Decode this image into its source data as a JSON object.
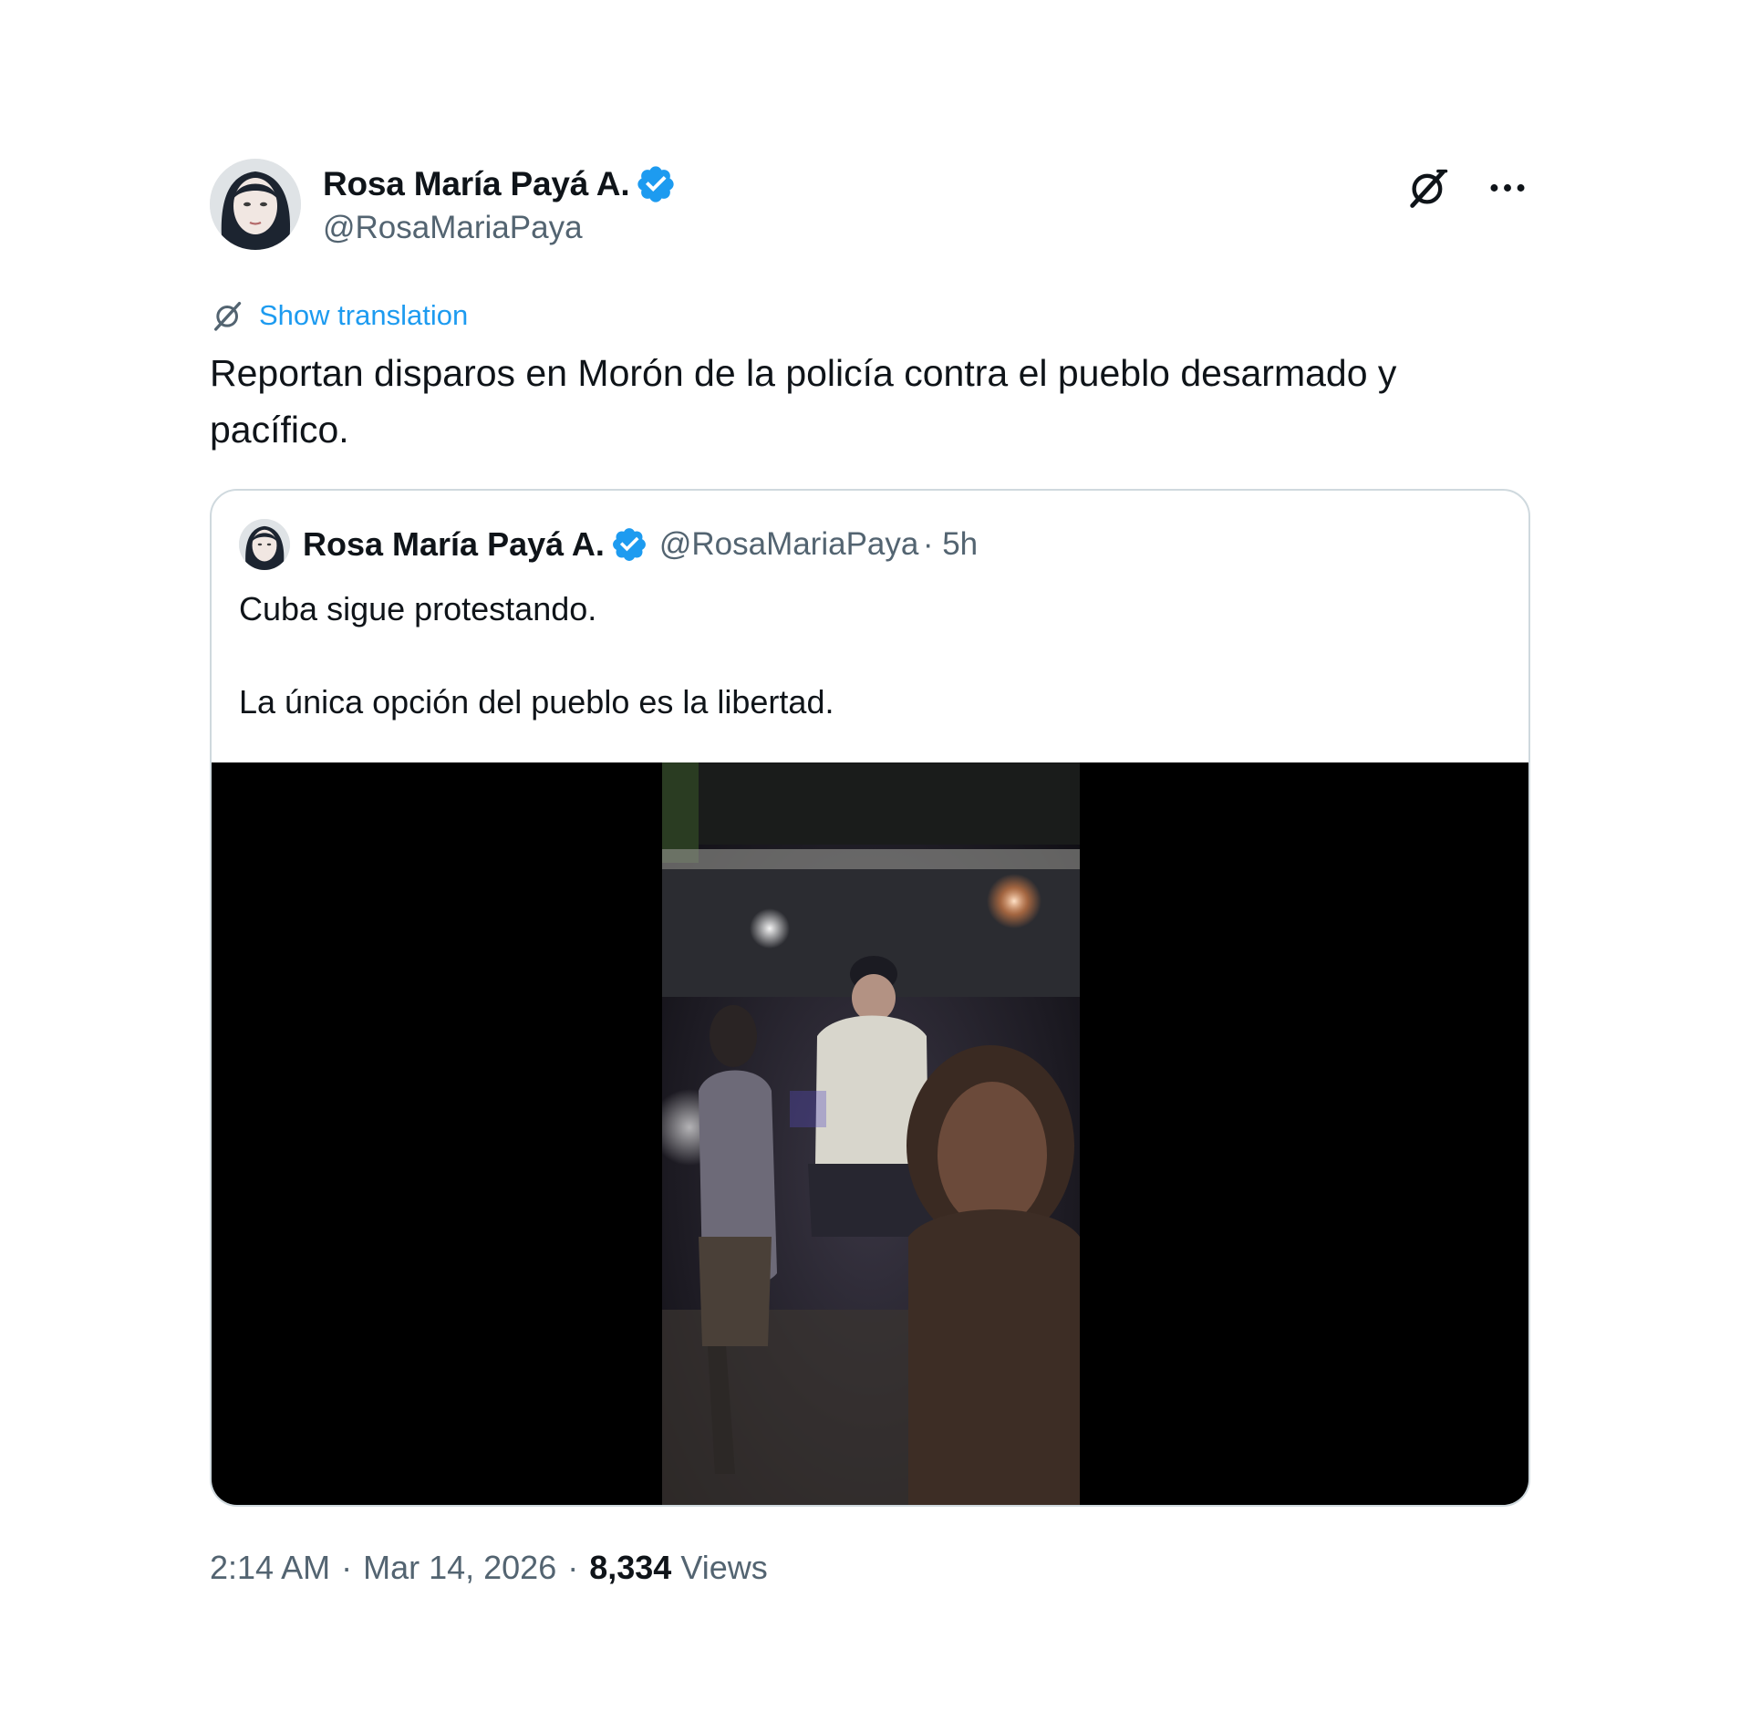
{
  "author": {
    "name": "Rosa María Payá A.",
    "handle": "@RosaMariaPaya",
    "verified": true
  },
  "actions": {
    "grok_icon": "grok-icon",
    "more_icon": "more-icon"
  },
  "translation": {
    "label": "Show translation"
  },
  "tweet": {
    "text": "Reportan disparos en Morón de la policía contra el pueblo desarmado y pacífico."
  },
  "quote": {
    "name": "Rosa María Payá A.",
    "handle": "@RosaMariaPaya",
    "time": "· 5h",
    "lines": [
      "Cuba sigue protestando.",
      "La única opción del pueblo es la libertad."
    ],
    "media_type": "video"
  },
  "meta": {
    "time": "2:14 AM",
    "date": "Mar 14, 2026",
    "views_count": "8,334",
    "views_label": "Views"
  },
  "colors": {
    "accent": "#1d9bf0",
    "text": "#0f1419",
    "secondary": "#536471",
    "border": "#cfd9de"
  }
}
